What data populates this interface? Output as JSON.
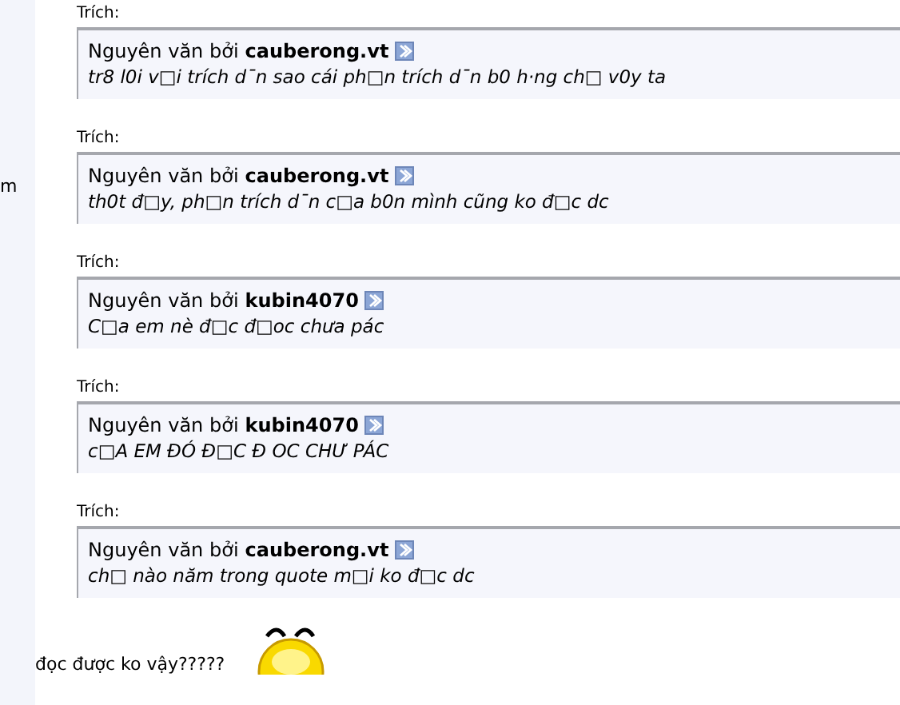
{
  "sidebar": {
    "text": "m"
  },
  "quotes": [
    {
      "label": "Trích:",
      "prefix": "Nguyên văn bởi",
      "author": "cauberong.vt",
      "text": "tr8 l0i v□i trích d¯n sao cái ph□n trích d¯n b0 h·ng ch□ v0y ta"
    },
    {
      "label": "Trích:",
      "prefix": "Nguyên văn bởi",
      "author": "cauberong.vt",
      "text": "th0t đ□y, ph□n trích d¯n c□a b0n mình cũng ko đ□c dc"
    },
    {
      "label": "Trích:",
      "prefix": "Nguyên văn bởi",
      "author": "kubin4070",
      "text": "C□a em nè đ□c đ□oc chưa pác"
    },
    {
      "label": "Trích:",
      "prefix": "Nguyên văn bởi",
      "author": "kubin4070",
      "text": "c□A EM ĐÓ Đ□C Đ OC CHƯ PÁC"
    },
    {
      "label": "Trích:",
      "prefix": "Nguyên văn bởi",
      "author": "cauberong.vt",
      "text": "ch□ nào năm trong quote m□i ko đ□c dc"
    }
  ],
  "message": "đọc được ko vậy?????"
}
